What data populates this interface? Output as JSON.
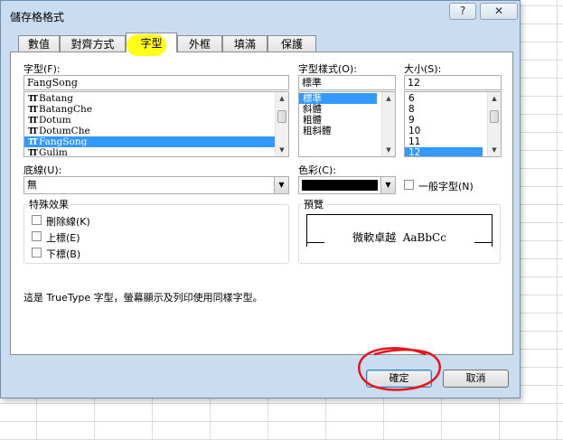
{
  "dialog": {
    "title": "儲存格格式",
    "help_glyph": "?",
    "close_glyph": "✕"
  },
  "tabs": [
    {
      "label": "數值"
    },
    {
      "label": "對齊方式"
    },
    {
      "label": "字型"
    },
    {
      "label": "外框"
    },
    {
      "label": "填滿"
    },
    {
      "label": "保護"
    }
  ],
  "font": {
    "label": "字型(F):",
    "value": "FangSong",
    "items": [
      {
        "icon": "truetype-icon",
        "name": "Batang"
      },
      {
        "icon": "truetype-icon",
        "name": "BatangChe"
      },
      {
        "icon": "truetype-icon",
        "name": "Dotum"
      },
      {
        "icon": "truetype-icon",
        "name": "DotumChe"
      },
      {
        "icon": "truetype-icon",
        "name": "FangSong",
        "selected": true
      },
      {
        "icon": "truetype-icon",
        "name": "Gulim"
      }
    ]
  },
  "style": {
    "label": "字型樣式(O):",
    "value": "標準",
    "items": [
      "標準",
      "斜體",
      "粗體",
      "粗斜體"
    ]
  },
  "size": {
    "label": "大小(S):",
    "value": "12",
    "items": [
      "6",
      "8",
      "9",
      "10",
      "11",
      "12"
    ]
  },
  "underline": {
    "label": "底線(U):",
    "value": "無"
  },
  "color": {
    "label": "色彩(C):",
    "swatch": "#000000"
  },
  "normal_font": {
    "label": "一般字型(N)"
  },
  "effects": {
    "title": "特殊效果",
    "items": [
      "刪除線(K)",
      "上標(E)",
      "下標(B)"
    ]
  },
  "preview": {
    "title": "預覽",
    "sample": "微軟卓越  AaBbCc"
  },
  "note": "這是 TrueType 字型，螢幕顯示及列印使用同樣字型。",
  "buttons": {
    "ok": "確定",
    "cancel": "取消"
  },
  "annotations": {
    "highlight_color": "#ffff00",
    "circle_color": "#e8141c"
  }
}
